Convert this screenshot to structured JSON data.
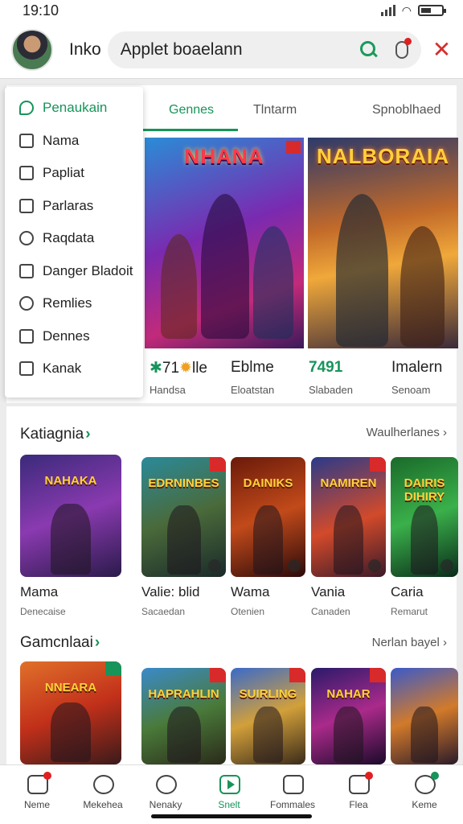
{
  "status": {
    "time": "19:10"
  },
  "header": {
    "label": "Inko",
    "search_text": "Applet boaelann"
  },
  "tabs": [
    {
      "label": "Gennes",
      "active": true
    },
    {
      "label": "Tlntarm",
      "active": false
    },
    {
      "label": "Spnoblhaed",
      "active": false
    }
  ],
  "menu": {
    "items": [
      {
        "label": "Penaukain",
        "icon": "leaf-icon",
        "active": true
      },
      {
        "label": "Nama",
        "icon": "tag-icon"
      },
      {
        "label": "Papliat",
        "icon": "checkbox-icon"
      },
      {
        "label": "Parlaras",
        "icon": "checklist-icon"
      },
      {
        "label": "Raqdata",
        "icon": "search-icon"
      },
      {
        "label": "Danger Bladoit",
        "icon": "shield-icon"
      },
      {
        "label": "Remlies",
        "icon": "star-icon"
      },
      {
        "label": "Dennes",
        "icon": "box-icon"
      },
      {
        "label": "Kanak",
        "icon": "checkmark-icon"
      }
    ]
  },
  "featured": [
    {
      "title": "NHANA"
    },
    {
      "title": "NALBORAIA"
    }
  ],
  "stats": [
    {
      "value": "71",
      "suffix": "lle",
      "sub": "Handsa",
      "green": false
    },
    {
      "value": "Eblme",
      "sub": "Eloatstan",
      "green": false
    },
    {
      "value": "7491",
      "sub": "Slabaden",
      "green": true
    },
    {
      "value": "Imalern",
      "sub": "Senoam",
      "green": false
    }
  ],
  "section1": {
    "title": "Katiagnia",
    "link": "Waulherlanes",
    "cards": [
      {
        "art": "NAHAKA",
        "name": "Mama",
        "sub": "Denecaise"
      },
      {
        "art": "EDRNINBES",
        "name": "Valie: blid",
        "sub": "Sacaedan"
      },
      {
        "art": "DAINIKS",
        "name": "Wama",
        "sub": "Otenien"
      },
      {
        "art": "NAMIREN",
        "name": "Vania",
        "sub": "Canaden"
      },
      {
        "art": "DAIRIS DIHIRY",
        "name": "Caria",
        "sub": "Remarut"
      }
    ]
  },
  "section2": {
    "title": "Gamcnlaai",
    "link": "Nerlan bayel",
    "cards": [
      {
        "art": "NNEARA"
      },
      {
        "art": "HAPRAHLIN"
      },
      {
        "art": "SUIRLING"
      },
      {
        "art": "NAHAR"
      },
      {
        "art": ""
      }
    ]
  },
  "bottom_nav": [
    {
      "label": "Neme",
      "icon": "home-icon"
    },
    {
      "label": "Mekehea",
      "icon": "search-icon"
    },
    {
      "label": "Nenaky",
      "icon": "clock-icon"
    },
    {
      "label": "Snelt",
      "icon": "play-icon",
      "active": true
    },
    {
      "label": "Fommales",
      "icon": "chat-icon"
    },
    {
      "label": "Flea",
      "icon": "calendar-icon"
    },
    {
      "label": "Keme",
      "icon": "settings-icon"
    }
  ],
  "colors": {
    "accent": "#17945a",
    "alert": "#e02020"
  }
}
